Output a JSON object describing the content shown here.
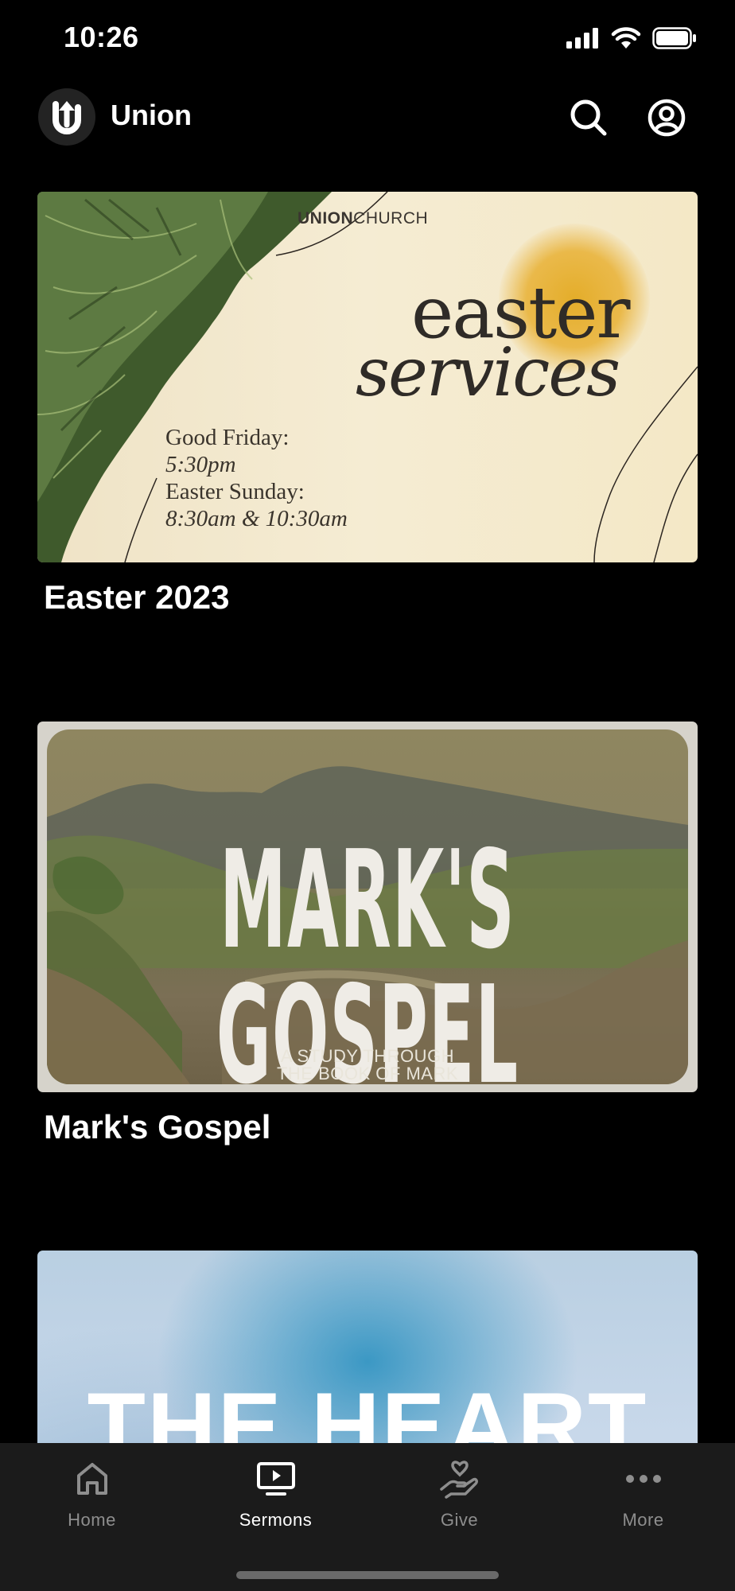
{
  "status_bar": {
    "time": "10:26"
  },
  "header": {
    "app_name": "Union"
  },
  "series": [
    {
      "title": "Easter 2023",
      "artwork": {
        "brand_bold": "UNION",
        "brand_light": "CHURCH",
        "headline_1": "easter",
        "headline_2": "services",
        "schedule_1": "Good Friday:",
        "schedule_2": "5:30pm",
        "schedule_3": "Easter Sunday:",
        "schedule_4": "8:30am & 10:30am"
      }
    },
    {
      "title": "Mark's Gospel",
      "artwork": {
        "headline": "MARK'S GOSPEL",
        "subtitle_1": "A STUDY THROUGH",
        "subtitle_2": "THE BOOK OF MARK"
      }
    },
    {
      "title": "",
      "artwork": {
        "headline": "THE HEART"
      }
    }
  ],
  "tab_bar": {
    "tabs": [
      {
        "label": "Home",
        "icon": "home-icon",
        "active": false
      },
      {
        "label": "Sermons",
        "icon": "tv-play-icon",
        "active": true
      },
      {
        "label": "Give",
        "icon": "hand-heart-icon",
        "active": false
      },
      {
        "label": "More",
        "icon": "more-dots-icon",
        "active": false
      }
    ]
  },
  "colors": {
    "background": "#000000",
    "tab_bar_background": "#1b1b1b",
    "tab_inactive": "#8e8e8e",
    "tab_active": "#ffffff"
  }
}
